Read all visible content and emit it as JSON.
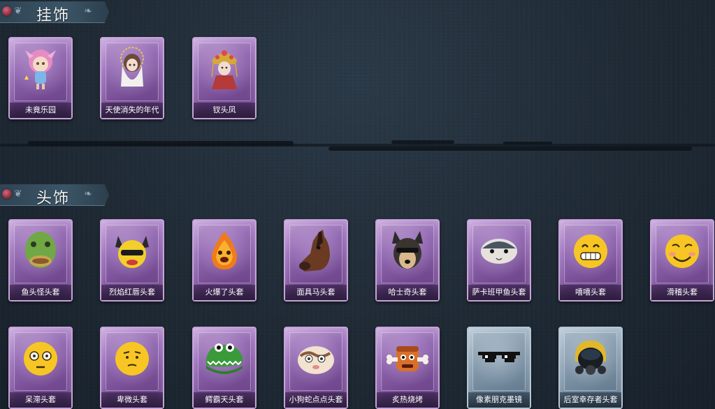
{
  "sections": {
    "pendants": {
      "title": "挂饰",
      "items": [
        {
          "name": "未竟乐园",
          "icon": "pink-hair-chibi-doll-icon"
        },
        {
          "name": "天使消失的年代",
          "icon": "angel-chibi-doll-icon"
        },
        {
          "name": "钗头凤",
          "icon": "opera-headdress-doll-icon"
        }
      ]
    },
    "headwear": {
      "title": "头饰",
      "row1": [
        {
          "name": "鱼头怪头套",
          "icon": "fish-head-mask-icon"
        },
        {
          "name": "烈焰红唇头套",
          "icon": "yellow-creature-mask-icon"
        },
        {
          "name": "火爆了头套",
          "icon": "fire-head-mask-icon"
        },
        {
          "name": "面具马头套",
          "icon": "horse-head-mask-icon"
        },
        {
          "name": "哈士奇头套",
          "icon": "husky-head-mask-icon"
        },
        {
          "name": "萨卡班甲鱼头套",
          "icon": "sacabambaspis-head-mask-icon"
        },
        {
          "name": "嘻嘻头套",
          "icon": "grinning-emoji-mask-icon"
        },
        {
          "name": "滑稽头套",
          "icon": "funny-emoji-mask-icon"
        }
      ],
      "row2": [
        {
          "name": "呆滞头套",
          "icon": "dazed-emoji-mask-icon"
        },
        {
          "name": "卑微头套",
          "icon": "humble-emoji-mask-icon"
        },
        {
          "name": "鳄霸天头套",
          "icon": "crocodile-head-mask-icon"
        },
        {
          "name": "小狗蛇点点头套",
          "icon": "dog-snake-mask-icon"
        },
        {
          "name": "炙热烧烤",
          "icon": "grilled-meat-mask-icon"
        },
        {
          "name": "像素朋克墨镜",
          "icon": "pixel-sunglasses-icon"
        },
        {
          "name": "后室幸存者头套",
          "icon": "gas-mask-helmet-icon"
        }
      ]
    }
  },
  "colors": {
    "purple_rarity": "#9a6fbb",
    "blue_rarity": "#8da3b6",
    "background": "#1f2a35"
  }
}
